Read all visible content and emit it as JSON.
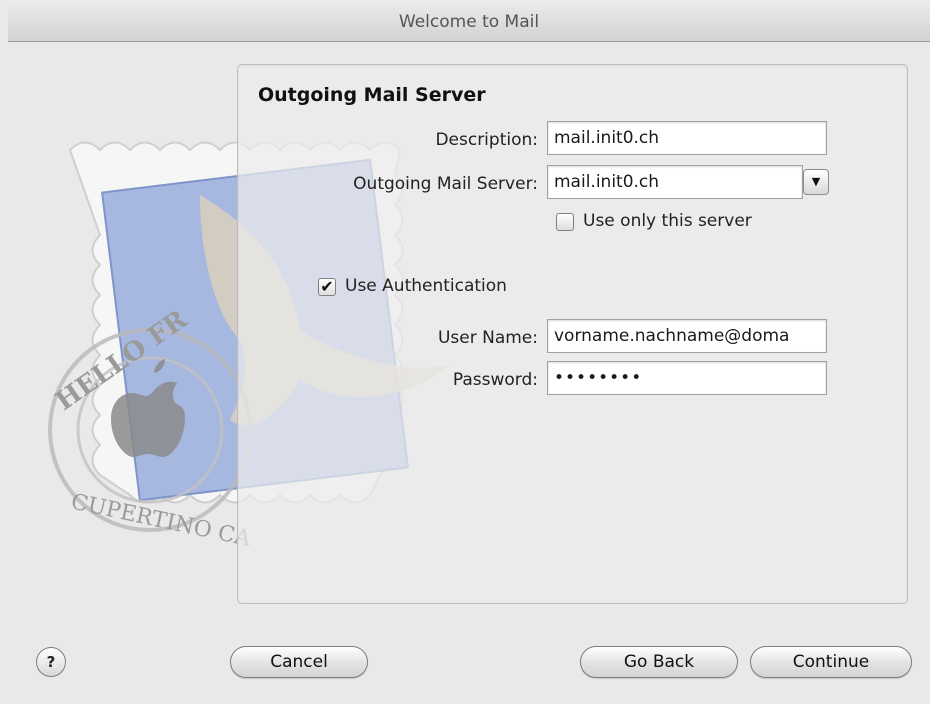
{
  "window": {
    "title": "Welcome to Mail"
  },
  "panel": {
    "heading": "Outgoing Mail Server"
  },
  "form": {
    "description_label": "Description:",
    "description_value": "mail.init0.ch",
    "server_label": "Outgoing Mail Server:",
    "server_value": "mail.init0.ch",
    "use_only_label": "Use only this server",
    "use_only_checked": false,
    "use_auth_label": "Use Authentication",
    "use_auth_checked": true,
    "username_label": "User Name:",
    "username_value": "vorname.nachname@doma",
    "password_label": "Password:",
    "password_value": "••••••••"
  },
  "stamp": {
    "top_text": "HELLO FR",
    "bottom_text": "CUPERTINO CA"
  },
  "buttons": {
    "help": "?",
    "cancel": "Cancel",
    "go_back": "Go Back",
    "continue": "Continue"
  },
  "icons": {
    "combo": "chevron-down-icon",
    "check": "checkmark-icon"
  }
}
